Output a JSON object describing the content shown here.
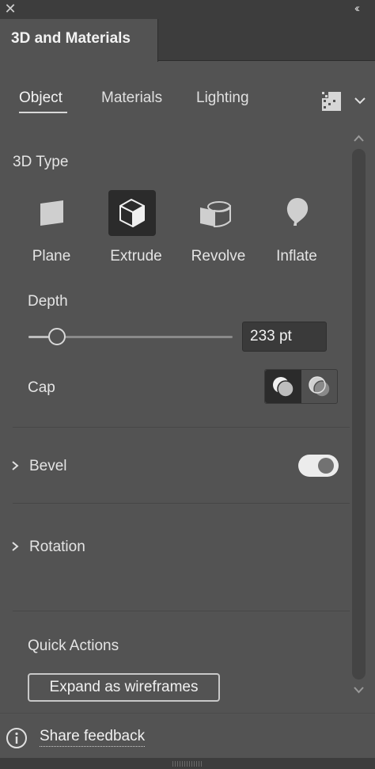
{
  "window": {
    "close_glyph": "✕",
    "collapse_glyph": "‹‹"
  },
  "panel": {
    "title": "3D and Materials"
  },
  "subtabs": [
    {
      "label": "Object",
      "active": true
    },
    {
      "label": "Materials",
      "active": false
    },
    {
      "label": "Lighting",
      "active": false
    }
  ],
  "header_icons": {
    "render": "render-settings-icon",
    "menu": "chevron-down-icon"
  },
  "type_section": {
    "title": "3D Type",
    "types": [
      {
        "label": "Plane",
        "icon": "plane-icon",
        "selected": false
      },
      {
        "label": "Extrude",
        "icon": "extrude-cube-icon",
        "selected": true
      },
      {
        "label": "Revolve",
        "icon": "revolve-icon",
        "selected": false
      },
      {
        "label": "Inflate",
        "icon": "inflate-balloon-icon",
        "selected": false
      }
    ]
  },
  "depth": {
    "label": "Depth",
    "value": "233 pt",
    "slider_fraction": 0.14
  },
  "cap": {
    "label": "Cap",
    "options": [
      "cap-on-icon",
      "cap-off-icon"
    ],
    "selected_index": 0
  },
  "bevel": {
    "label": "Bevel",
    "toggle_on": true
  },
  "rotation": {
    "label": "Rotation"
  },
  "quick_actions": {
    "title": "Quick Actions",
    "expand_button": "Expand as wireframes"
  },
  "footer": {
    "feedback_label": "Share feedback"
  },
  "colors": {
    "panel_bg": "#535353",
    "chrome_bg": "#3d3d3d",
    "selected_bg": "#2b2b2b",
    "text": "#e4e4e4"
  }
}
